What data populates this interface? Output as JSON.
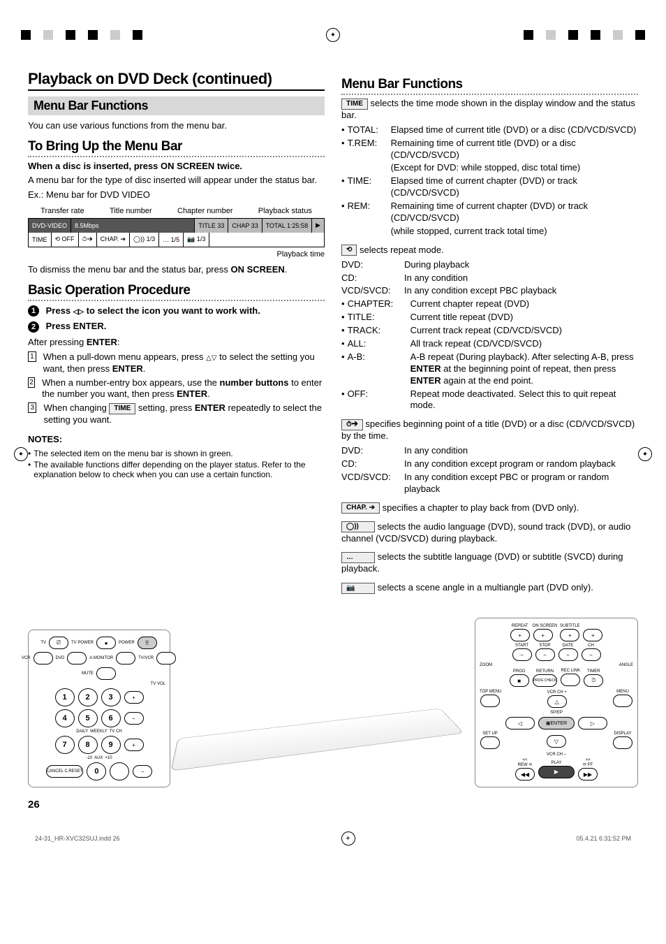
{
  "header": {
    "title": "Playback on DVD Deck (continued)"
  },
  "left": {
    "section_bar": "Menu Bar Functions",
    "intro": "You can use various functions from the menu bar.",
    "bringup_title": "To Bring Up the Menu Bar",
    "bringup_bold": "When a disc is inserted, press ON SCREEN twice.",
    "bringup_p1": "A menu bar for the type of disc inserted will appear under the status bar.",
    "bringup_ex": "Ex.: Menu bar for DVD VIDEO",
    "fig": {
      "transfer": "Transfer rate",
      "titlenum": "Title number",
      "chapternum": "Chapter number",
      "pbstatus": "Playback status",
      "osd_top_disc": "DVD-VIDEO",
      "osd_top_rate": "8.5Mbps",
      "osd_top_title": "TITLE 33",
      "osd_top_chap": "CHAP 33",
      "osd_top_total": "TOTAL 1:25:58",
      "osd_bot_time": "TIME",
      "osd_bot_off": "⟲ OFF",
      "osd_bot_clock": "⏱➔",
      "osd_bot_chap": "CHAP. ➔",
      "osd_bot_audio": "◯)) 1/3",
      "osd_bot_sub": "… 1/5",
      "osd_bot_angle": "📷 1/3",
      "pbtime": "Playback time"
    },
    "dismiss_p1_a": "To dismiss the menu bar and the status bar, press ",
    "dismiss_p1_b": "ON SCREEN",
    "dismiss_p1_c": ".",
    "basic_title": "Basic Operation Procedure",
    "step1_num": "1",
    "step1_a": "Press ",
    "step1_b": " to select the icon you want to work with.",
    "step2_num": "2",
    "step2": "Press ENTER.",
    "after_enter_a": "After pressing ",
    "after_enter_b": "ENTER",
    "after_enter_c": ":",
    "li1_num": "1",
    "li1_a": "When a pull-down menu appears, press ",
    "li1_b": " to select the setting you want, then press ",
    "li1_c": "ENTER",
    "li1_d": ".",
    "li2_num": "2",
    "li2_a": "When a number-entry box appears, use the ",
    "li2_b": "number buttons",
    "li2_c": " to enter the number you want, then press ",
    "li2_d": "ENTER",
    "li2_e": ".",
    "li3_num": "3",
    "li3_a": "When changing ",
    "li3_icon": "TIME",
    "li3_b": " setting, press ",
    "li3_c": "ENTER",
    "li3_d": " repeatedly to select the setting you want.",
    "notes_head": "NOTES:",
    "note1": "The selected item on the menu bar is shown in green.",
    "note2": "The available functions differ depending on the player status. Refer to the explanation below to check when you can use a certain function."
  },
  "right": {
    "title": "Menu Bar Functions",
    "time_icon": "TIME",
    "time_intro": " selects the time mode shown in the display window and the status bar.",
    "time_items": [
      {
        "lbl": "TOTAL:",
        "txt": "Elapsed time of current title (DVD) or a disc (CD/VCD/SVCD)"
      },
      {
        "lbl": "T.REM:",
        "txt": "Remaining time of current title (DVD) or a disc (CD/VCD/SVCD)"
      },
      {
        "lbl": "",
        "txt": "(Except for DVD: while stopped, disc total time)"
      },
      {
        "lbl": "TIME:",
        "txt": "Elapsed time of current chapter (DVD) or track (CD/VCD/SVCD)"
      },
      {
        "lbl": "REM:",
        "txt": "Remaining time of current chapter (DVD) or track (CD/VCD/SVCD)"
      },
      {
        "lbl": "",
        "txt": "(while stopped, current track total time)"
      }
    ],
    "repeat_icon": "⟲",
    "repeat_intro": " selects repeat mode.",
    "repeat_disc": [
      {
        "lbl": "DVD:",
        "txt": "During playback"
      },
      {
        "lbl": "CD:",
        "txt": "In any condition"
      },
      {
        "lbl": "VCD/SVCD:",
        "txt": "In any condition except PBC playback"
      }
    ],
    "repeat_modes": [
      {
        "lbl": "CHAPTER:",
        "txt": "Current chapter repeat (DVD)"
      },
      {
        "lbl": "TITLE:",
        "txt": "Current title repeat (DVD)"
      },
      {
        "lbl": "TRACK:",
        "txt": "Current track repeat (CD/VCD/SVCD)"
      },
      {
        "lbl": "ALL:",
        "txt": "All track repeat (CD/VCD/SVCD)"
      }
    ],
    "ab_lbl": "A-B:",
    "ab_a": "A-B repeat (During playback). After selecting A-B, press ",
    "ab_b": "ENTER",
    "ab_c": " at the beginning point of repeat, then press ",
    "ab_d": "ENTER",
    "ab_e": " again at the end point.",
    "off_lbl": "OFF:",
    "off_txt": "Repeat mode deactivated. Select this to quit repeat mode.",
    "timesearch_icon": "⏱➔",
    "timesearch_txt": " specifies beginning point of a title (DVD) or a disc (CD/VCD/SVCD) by the time.",
    "timesearch_rows": [
      {
        "lbl": "DVD:",
        "txt": "In any condition"
      },
      {
        "lbl": "CD:",
        "txt": "In any condition except program or random playback"
      },
      {
        "lbl": "VCD/SVCD:",
        "txt": "In any condition except PBC or program or random playback"
      }
    ],
    "chap_icon": "CHAP. ➔",
    "chap_txt": " specifies a chapter to play back from (DVD only).",
    "audio_icon": "◯))",
    "audio_txt": " selects the audio language (DVD), sound track (DVD), or audio channel (VCD/SVCD) during playback.",
    "sub_icon": "…",
    "sub_txt": " selects the subtitle language (DVD) or subtitle (SVCD) during playback.",
    "angle_icon": "📷",
    "angle_txt": " selects a scene angle in a multiangle part (DVD only)."
  },
  "remote_left": {
    "labels": {
      "tv": "TV",
      "tvpower": "TV POWER",
      "power": "POWER",
      "vcr": "VCR",
      "dvd": "DVD",
      "amonitor": "A.MONITOR",
      "tvvcr": "TV/VCR",
      "mute": "MUTE",
      "tvvol": "TV VOL",
      "daily": "DAILY",
      "weekly": "WEEKLY",
      "tvch": "TV CH",
      "aux": "AUX",
      "cancel": "CANCEL C.RESET"
    },
    "nums": [
      "1",
      "2",
      "3",
      "4",
      "5",
      "6",
      "7",
      "8",
      "9",
      "0"
    ],
    "minus10": "-10",
    "plus10": "+10"
  },
  "remote_right": {
    "labels": {
      "repeat": "REPEAT",
      "onscreen": "ON SCREEN",
      "subtitle": "SUBTITLE",
      "start": "START",
      "stop": "STOP",
      "date": "DATE",
      "ch": "CH",
      "zoom": "ZOOM",
      "angle": "ANGLE",
      "prog": "PROG",
      "return": "RETURN",
      "reclink": "REC LINK",
      "timer": "TIMER",
      "progcheck": "PROG CHECK",
      "topmenu": "TOP MENU",
      "vcrchp": "VCR CH +",
      "menu": "MENU",
      "spep": "SP/EP",
      "enter": "ENTER",
      "setup": "SET UP",
      "display": "DISPLAY",
      "vcrchm": "VCR CH –",
      "rew": "REW",
      "play": "PLAY",
      "ff": "FF"
    }
  },
  "footer": {
    "pagenum": "26",
    "file": "24-31_HR-XVC32SUJ.indd   26",
    "timestamp": "05.4.21   6:31:52 PM"
  }
}
